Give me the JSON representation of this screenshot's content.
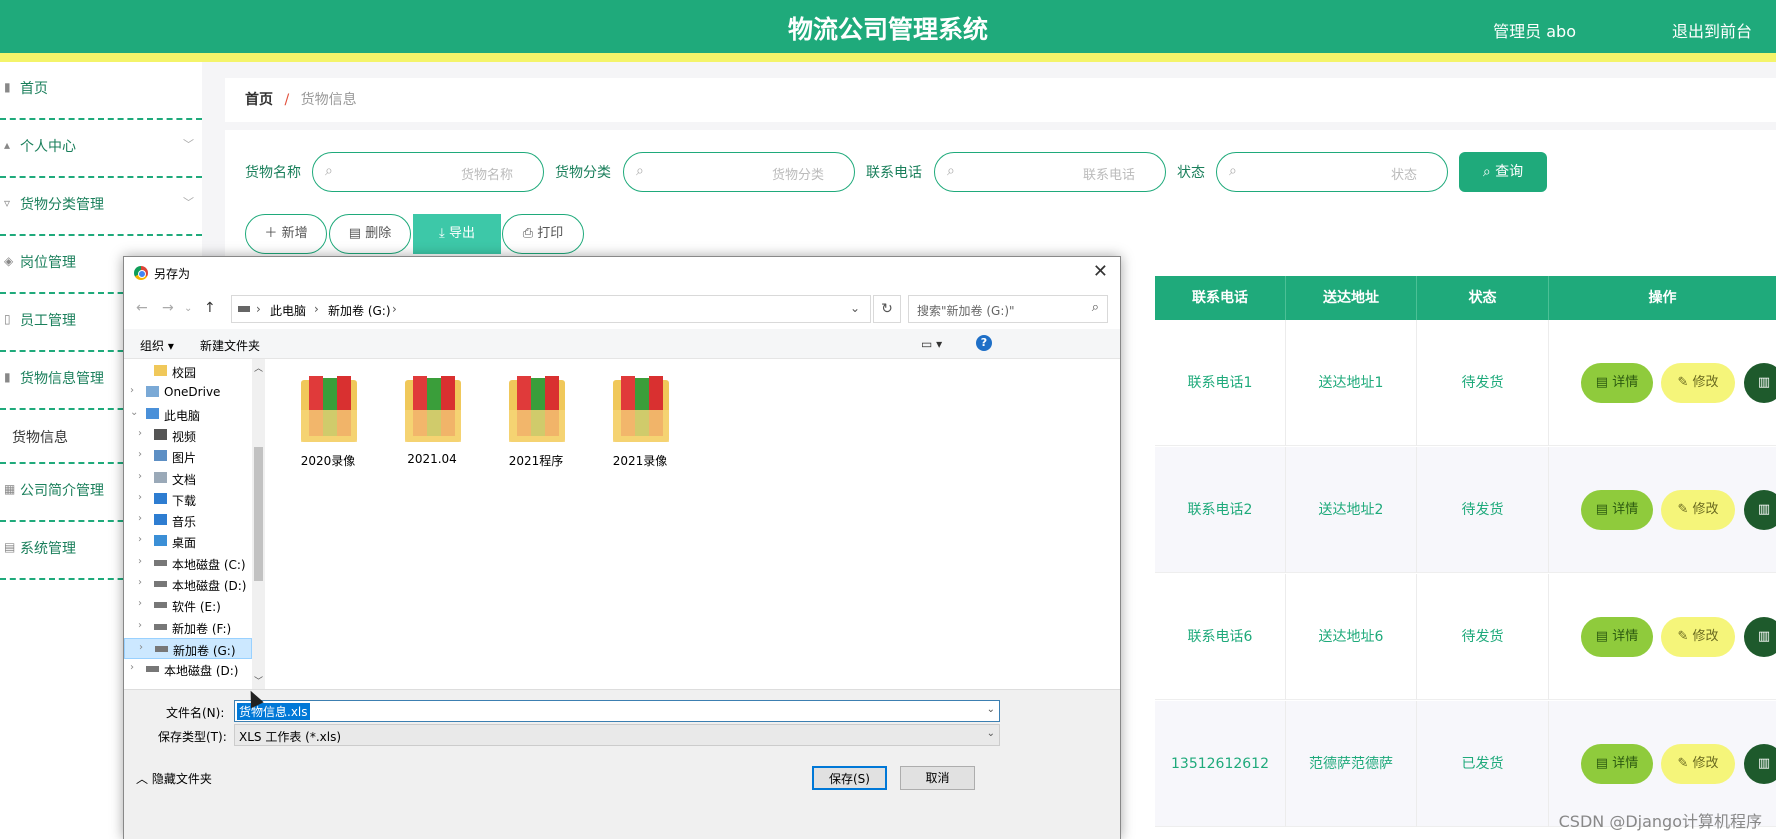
{
  "header": {
    "title": "物流公司管理系统",
    "user": "管理员 abo",
    "logout": "退出到前台"
  },
  "sidebar": {
    "items": [
      {
        "label": "首页",
        "icon": "home-icon"
      },
      {
        "label": "个人中心",
        "icon": "user-icon"
      },
      {
        "label": "货物分类管理",
        "icon": "category-icon"
      },
      {
        "label": "岗位管理",
        "icon": "post-icon"
      },
      {
        "label": "员工管理",
        "icon": "staff-icon"
      },
      {
        "label": "货物信息管理",
        "icon": "goods-icon"
      }
    ],
    "sub_item": "货物信息",
    "items2": [
      {
        "label": "公司简介管理",
        "icon": "company-icon"
      },
      {
        "label": "系统管理",
        "icon": "system-icon"
      }
    ]
  },
  "breadcrumb": {
    "home": "首页",
    "sep": "/",
    "current": "货物信息"
  },
  "search": {
    "fields": [
      {
        "label": "货物名称",
        "placeholder": "货物名称"
      },
      {
        "label": "货物分类",
        "placeholder": "货物分类"
      },
      {
        "label": "联系电话",
        "placeholder": "联系电话"
      },
      {
        "label": "状态",
        "placeholder": "状态"
      }
    ],
    "query_label": "查询"
  },
  "actions": {
    "add": "新增",
    "delete": "删除",
    "export": "导出",
    "print": "打印"
  },
  "table": {
    "headers": [
      "联系电话",
      "送达地址",
      "状态",
      "操作"
    ],
    "rows": [
      {
        "phone": "联系电话1",
        "address": "送达地址1",
        "status": "待发货"
      },
      {
        "phone": "联系电话2",
        "address": "送达地址2",
        "status": "待发货"
      },
      {
        "phone": "联系电话6",
        "address": "送达地址6",
        "status": "待发货"
      },
      {
        "phone": "13512612612",
        "address": "范德萨范德萨",
        "status": "已发货"
      }
    ],
    "op_detail": "详情",
    "op_edit": "修改",
    "op_delete_icon": "trash-icon"
  },
  "dialog": {
    "title": "另存为",
    "path": [
      "此电脑",
      "新加卷 (G:)"
    ],
    "search_placeholder": "搜索\"新加卷 (G:)\"",
    "organize": "组织 ▾",
    "new_folder": "新建文件夹",
    "tree": [
      {
        "label": "校园",
        "indent": 2
      },
      {
        "label": "OneDrive",
        "indent": 1
      },
      {
        "label": "此电脑",
        "indent": 1
      },
      {
        "label": "视频",
        "indent": 2
      },
      {
        "label": "图片",
        "indent": 2
      },
      {
        "label": "文档",
        "indent": 2
      },
      {
        "label": "下载",
        "indent": 2
      },
      {
        "label": "音乐",
        "indent": 2
      },
      {
        "label": "桌面",
        "indent": 2
      },
      {
        "label": "本地磁盘 (C:)",
        "indent": 2
      },
      {
        "label": "本地磁盘 (D:)",
        "indent": 2
      },
      {
        "label": "软件 (E:)",
        "indent": 2
      },
      {
        "label": "新加卷 (F:)",
        "indent": 2
      },
      {
        "label": "新加卷 (G:)",
        "indent": 2,
        "selected": true
      },
      {
        "label": "本地磁盘 (D:)",
        "indent": 1
      }
    ],
    "folders": [
      "2020录像",
      "2021.04",
      "2021程序",
      "2021录像"
    ],
    "filename_label": "文件名(N):",
    "filename": "货物信息.xls",
    "filetype_label": "保存类型(T):",
    "filetype": "XLS 工作表 (*.xls)",
    "hide_folders": "隐藏文件夹",
    "save": "保存(S)",
    "cancel": "取消"
  },
  "watermark": "CSDN @Django计算机程序"
}
